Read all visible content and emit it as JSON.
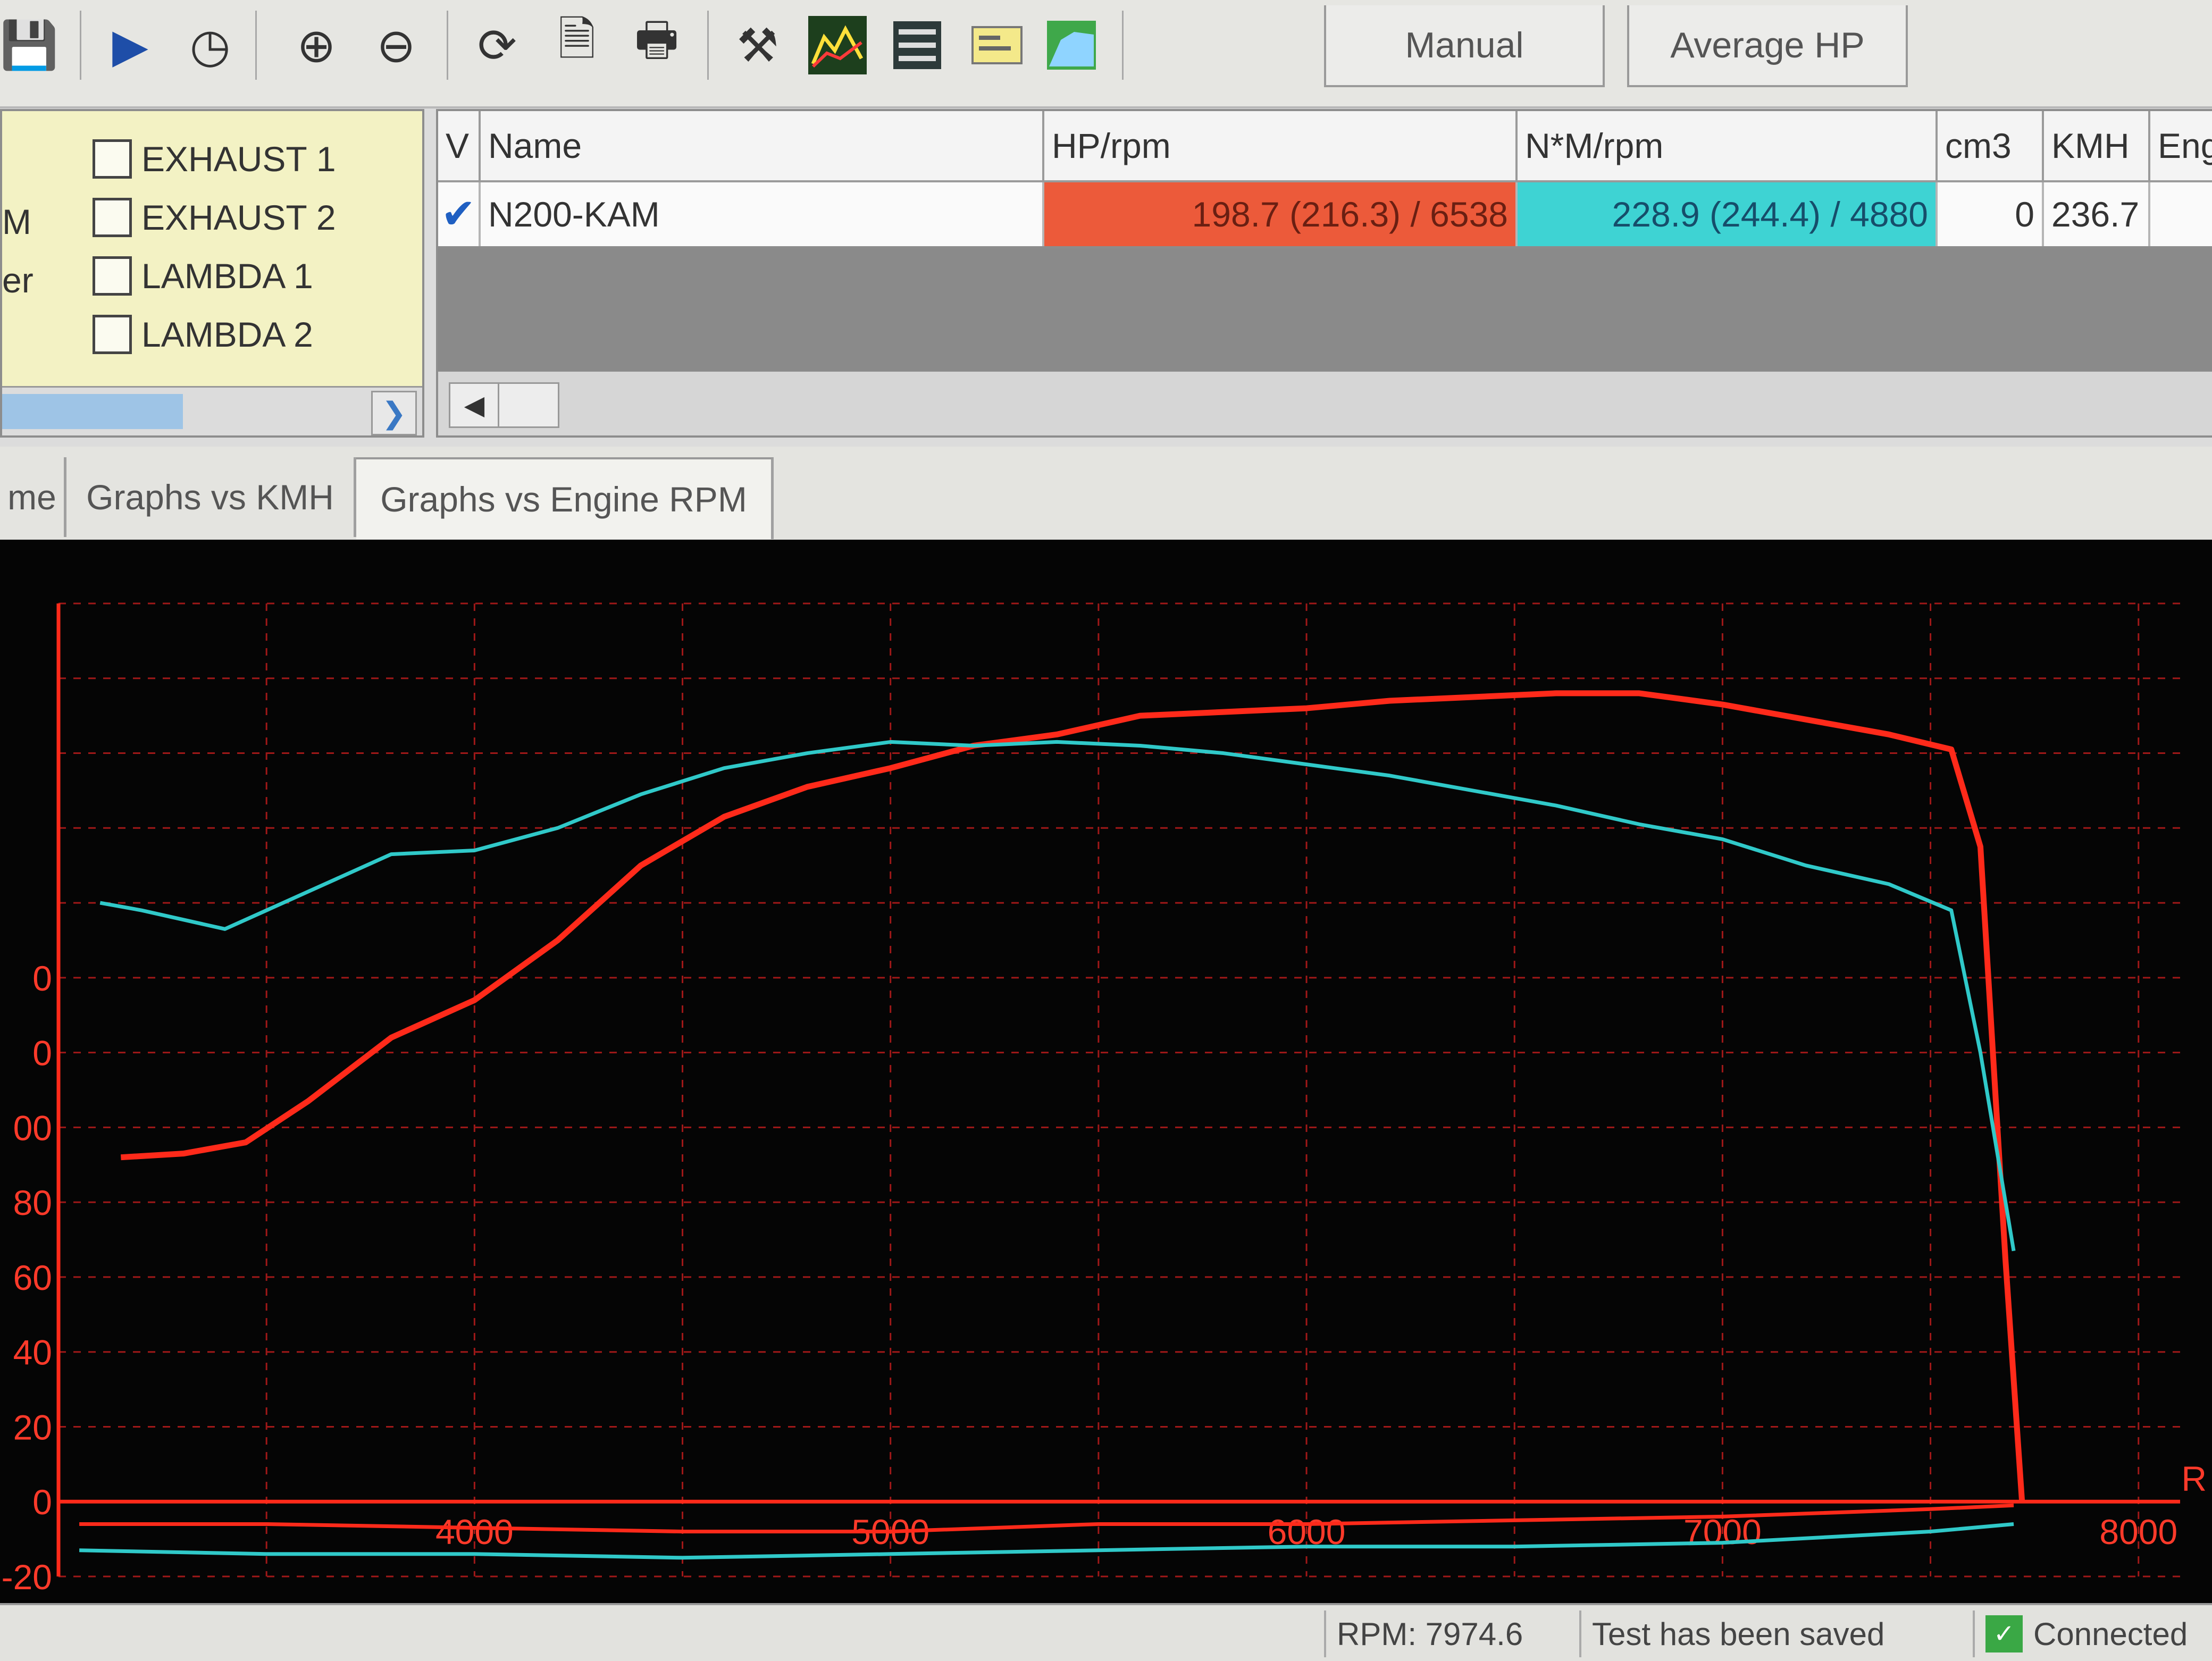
{
  "toolbar": {
    "icons": [
      "save-icon",
      "play-icon",
      "gauge-icon",
      "zoom-in-icon",
      "zoom-out-icon",
      "refresh-icon",
      "print-preview-icon",
      "print-icon",
      "tools-icon",
      "graph-color-icon",
      "list-icon",
      "note-icon",
      "chart-area-icon"
    ],
    "mode_tabs": [
      "Manual",
      "Average HP"
    ]
  },
  "channels": {
    "cut_labels": [
      "M",
      "er"
    ],
    "items": [
      {
        "label": "EXHAUST 1",
        "checked": false
      },
      {
        "label": "EXHAUST 2",
        "checked": false
      },
      {
        "label": "LAMBDA 1",
        "checked": false
      },
      {
        "label": "LAMBDA 2",
        "checked": false
      }
    ]
  },
  "results": {
    "headers": [
      "V",
      "Name",
      "HP/rpm",
      "N*M/rpm",
      "cm3",
      "KMH",
      "Eng"
    ],
    "row": {
      "visible": true,
      "name": "N200-KAM",
      "hp": "198.7 (216.3) / 6538",
      "torque": "228.9 (244.4) / 4880",
      "cm3": "0",
      "kmh": "236.7",
      "eng": ""
    },
    "hp_color": "#ec5a3a",
    "torque_color": "#3ed3d3"
  },
  "view_tabs": {
    "items": [
      "me",
      "Graphs vs KMH",
      "Graphs vs Engine RPM"
    ],
    "active": 2
  },
  "chart_data": {
    "type": "line",
    "xlabel": "R",
    "xlim": [
      3000,
      8100
    ],
    "ylim": [
      -20,
      240
    ],
    "x_ticks": [
      4000,
      5000,
      6000,
      7000,
      8000
    ],
    "y_ticks": [
      "-20",
      "0",
      "20",
      "40",
      "60",
      "80",
      "00",
      "0",
      "0"
    ],
    "grid": true,
    "series": [
      {
        "color": "#ff2a1a",
        "x": [
          3150,
          3300,
          3450,
          3600,
          3800,
          4000,
          4200,
          4400,
          4600,
          4800,
          5000,
          5200,
          5400,
          5600,
          5800,
          6000,
          6200,
          6400,
          6600,
          6800,
          7000,
          7200,
          7400,
          7550,
          7620,
          7680,
          7720
        ],
        "y": [
          92,
          93,
          96,
          107,
          124,
          134,
          150,
          170,
          183,
          191,
          196,
          202,
          205,
          210,
          211,
          212,
          214,
          215,
          216,
          216,
          213,
          209,
          205,
          201,
          175,
          65,
          0
        ]
      },
      {
        "color": "#30c9c9",
        "x": [
          3100,
          3200,
          3400,
          3600,
          3800,
          4000,
          4200,
          4400,
          4600,
          4800,
          5000,
          5200,
          5400,
          5600,
          5800,
          6000,
          6200,
          6400,
          6600,
          6800,
          7000,
          7200,
          7400,
          7550,
          7620,
          7700
        ],
        "y": [
          160,
          158,
          153,
          163,
          173,
          174,
          180,
          189,
          196,
          200,
          203,
          202,
          203,
          202,
          200,
          197,
          194,
          190,
          186,
          181,
          177,
          170,
          165,
          158,
          120,
          67
        ]
      },
      {
        "color": "#ff2a1a",
        "x": [
          3050,
          3500,
          4000,
          4500,
          5000,
          5500,
          6000,
          6500,
          7000,
          7500,
          7700
        ],
        "y": [
          -6,
          -6,
          -7,
          -8,
          -8,
          -6,
          -6,
          -5,
          -4,
          -2,
          -1
        ]
      },
      {
        "color": "#30c9c9",
        "x": [
          3050,
          3500,
          4000,
          4500,
          5000,
          5500,
          6000,
          6500,
          7000,
          7500,
          7700
        ],
        "y": [
          -13,
          -14,
          -14,
          -15,
          -14,
          -13,
          -12,
          -12,
          -11,
          -8,
          -6
        ]
      }
    ]
  },
  "status": {
    "items": [
      "RPM: 7974.6",
      "Test has been saved",
      "Connected"
    ]
  }
}
